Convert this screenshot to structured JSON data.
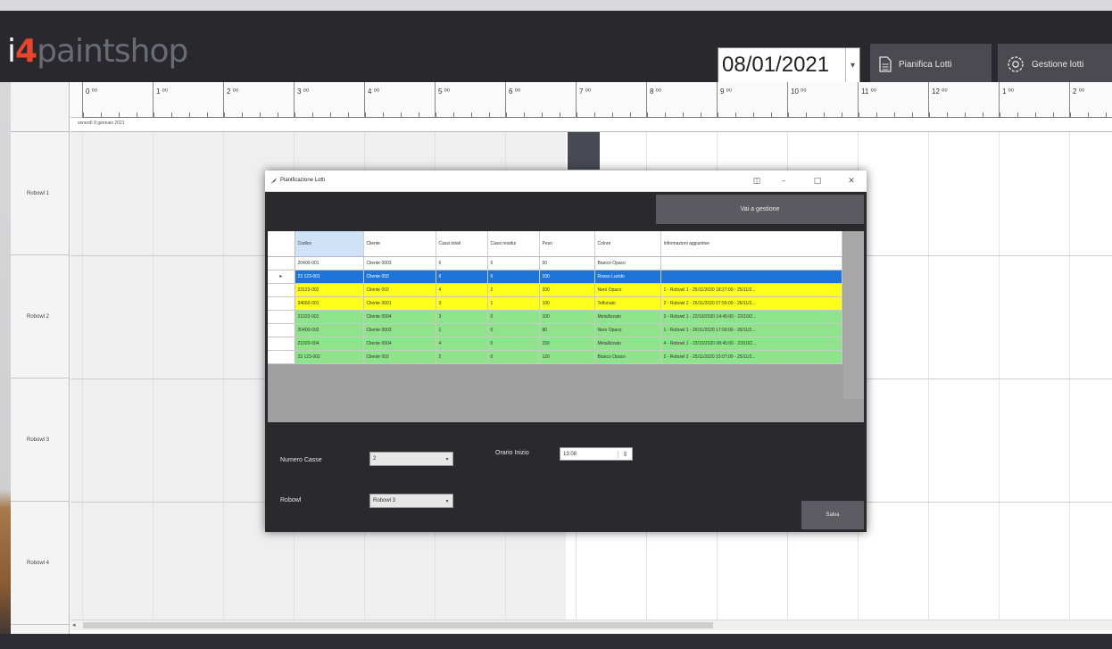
{
  "app": {
    "logo_i": "i",
    "logo_4": "4",
    "logo_rest": "paintshop",
    "date": "08/01/2021",
    "buttons": {
      "pianifica": "Pianifica Lotti",
      "gestione": "Gestione lotti"
    },
    "icons": {
      "pianifica": "document-icon",
      "gestione": "gear-icon"
    },
    "accent_color": "#e8442f"
  },
  "timeline": {
    "hours": [
      "0 ⁰⁰",
      "1 ⁰⁰",
      "2 ⁰⁰",
      "3 ⁰⁰",
      "4 ⁰⁰",
      "5 ⁰⁰",
      "6 ⁰⁰",
      "7 ⁰⁰",
      "8 ⁰⁰",
      "9 ⁰⁰",
      "10 ⁰⁰",
      "11 ⁰⁰",
      "12 ⁰⁰",
      "1 ⁰⁰",
      "2 ⁰⁰"
    ],
    "day_label": "venerdì 8 gennaio 2021",
    "rows": [
      "Robowl 1",
      "Robowl 2",
      "Robowl 3",
      "Robowl 4"
    ]
  },
  "dialog": {
    "title": "Pianificazione Lotti",
    "window_buttons": {
      "snap": "◫",
      "minimize": "–",
      "maximize": "□",
      "close": "✕"
    },
    "toolbar_button": "Vai a gestione",
    "table": {
      "columns": [
        "Codice",
        "Cliente",
        "Cassi totali",
        "Cassi residui",
        "Peso",
        "Colore",
        "Informazioni aggiuntive"
      ],
      "rows": [
        {
          "style": "white",
          "marker": "",
          "cells": [
            "20400-001",
            "Cliente 0003",
            "6",
            "6",
            "50",
            "Bianco Opaco",
            ""
          ]
        },
        {
          "style": "blue",
          "marker": "▸",
          "cells": [
            "23 123-001",
            "Cliente 002",
            "6",
            "6",
            "100",
            "Rosso Lucido",
            ""
          ]
        },
        {
          "style": "yellow",
          "marker": "",
          "cells": [
            "23123-002",
            "Cliente 002",
            "4",
            "2",
            "200",
            "Nero Opaco",
            "1 - Robowl 1 - 25/11/2020 18:27:00 - 25/11/2..."
          ]
        },
        {
          "style": "yellow",
          "marker": "",
          "cells": [
            "34660-001",
            "Cliente 0001",
            "3",
            "1",
            "100",
            "Teflonato",
            "2 - Robowl 2 - 26/11/2020 07:59:00 - 26/11/2..."
          ]
        },
        {
          "style": "green",
          "marker": "",
          "cells": [
            "21022-001",
            "Cliente 0004",
            "3",
            "0",
            "100",
            "Metallizzato",
            "3 - Robowl 1 - 22/10/2020 14:45:00 - 22/10/2..."
          ]
        },
        {
          "style": "green",
          "marker": "",
          "cells": [
            "20400-002",
            "Cliente 0003",
            "1",
            "0",
            "80",
            "Nero Opaco",
            "1 - Robowl 1 - 26/11/2020 17:09:00 - 26/11/2..."
          ]
        },
        {
          "style": "green",
          "marker": "",
          "cells": [
            "21020-004",
            "Cliente 0004",
            "4",
            "0",
            "150",
            "Metallizzato",
            "4 - Robowl 1 - 23/10/2020 08:45:00 - 23/10/2..."
          ]
        },
        {
          "style": "green",
          "marker": "",
          "cells": [
            "23 123-002",
            "Cliente 002",
            "2",
            "0",
            "120",
            "Bianco Opaco",
            "2 - Robowl 2 - 25/11/2020 15:07:00 - 25/11/2..."
          ]
        }
      ]
    },
    "form": {
      "numero_label": "Numero Casse",
      "numero_value": "2",
      "orario_label": "Orario Inizio",
      "orario_value": "13:08",
      "robowl_label": "Robowl",
      "robowl_value": "Robowl 3"
    },
    "save_button": "Salva"
  },
  "colors": {
    "row_white": "#ffffff",
    "row_blue": "#1e74d6",
    "row_yellow": "#ffff1a",
    "row_green": "#8fe38a"
  }
}
